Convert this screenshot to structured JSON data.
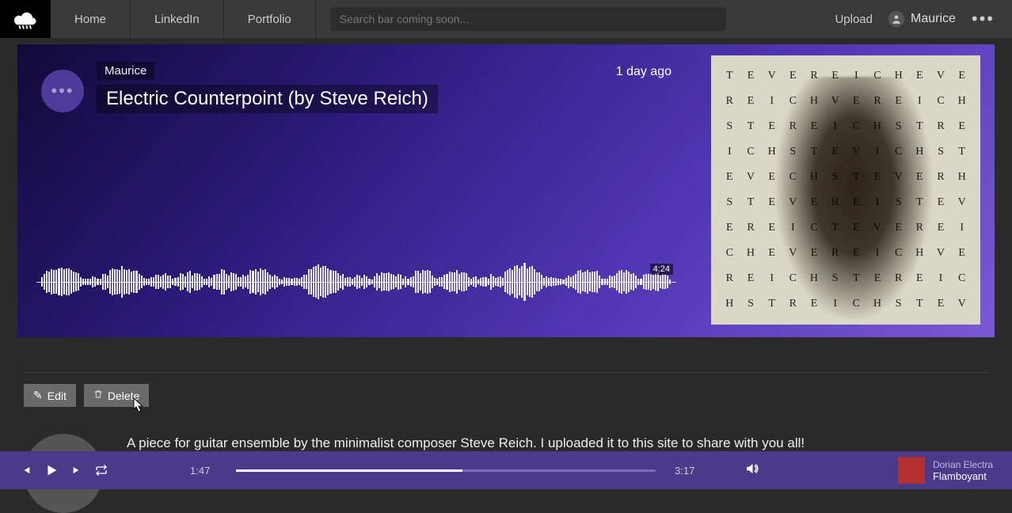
{
  "nav": {
    "items": [
      "Home",
      "LinkedIn",
      "Portfolio"
    ],
    "searchPlaceholder": "Search bar coming soon...",
    "upload": "Upload",
    "username": "Maurice"
  },
  "hero": {
    "artist": "Maurice",
    "title": "Electric Counterpoint (by Steve Reich)",
    "timeAgo": "1 day ago",
    "duration": "4:24",
    "albumLetters": "TEVEREICHEVEREICHVEREICHSTEREICHSTREICHSTEVICHSTEVECHSTEVERHSTEVEREISTEVEREIC"
  },
  "actions": {
    "edit": "Edit",
    "delete": "Delete"
  },
  "description": "A piece for guitar ensemble by the minimalist composer Steve Reich. I uploaded it to this site to share with you all!",
  "player": {
    "elapsed": "1:47",
    "total": "3:17",
    "progressPct": 54,
    "nowPlaying": {
      "artist": "Dorian Electra",
      "title": "Flamboyant"
    }
  }
}
